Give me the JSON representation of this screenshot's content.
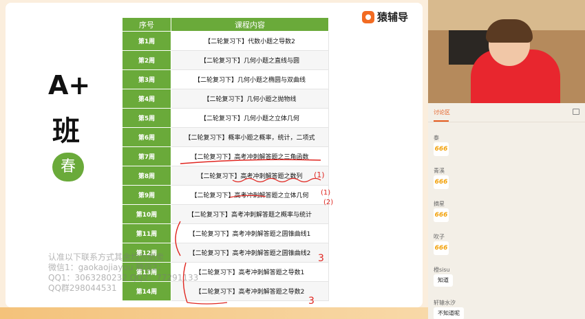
{
  "slide": {
    "grade_label": "A+",
    "class_label": "班",
    "season_badge": "春",
    "logo_text": "猿辅导"
  },
  "table": {
    "headers": [
      "序号",
      "课程内容"
    ],
    "rows": [
      {
        "week": "第1周",
        "topic": "【二轮复习下】代数小题之导数2"
      },
      {
        "week": "第2周",
        "topic": "【二轮复习下】几何小题之直线与圆"
      },
      {
        "week": "第3周",
        "topic": "【二轮复习下】几何小题之椭圆与双曲线"
      },
      {
        "week": "第4周",
        "topic": "【二轮复习下】几何小题之抛物线"
      },
      {
        "week": "第5周",
        "topic": "【二轮复习下】几何小题之立体几何"
      },
      {
        "week": "第6周",
        "topic": "【二轮复习下】概率小题之概率，统计，二项式"
      },
      {
        "week": "第7周",
        "topic": "【二轮复习下】高考冲刺解答题之三角函数"
      },
      {
        "week": "第8周",
        "topic": "【二轮复习下】高考冲刺解答题之数列"
      },
      {
        "week": "第9周",
        "topic": "【二轮复习下】高考冲刺解答题之立体几何"
      },
      {
        "week": "第10周",
        "topic": "【二轮复习下】高考冲刺解答题之概率与统计"
      },
      {
        "week": "第11周",
        "topic": "【二轮复习下】高考冲刺解答题之圆锥曲线1"
      },
      {
        "week": "第12周",
        "topic": "【二轮复习下】高考冲刺解答题之圆锥曲线2"
      },
      {
        "week": "第13周",
        "topic": "【二轮复习下】高考冲刺解答题之导数1"
      },
      {
        "week": "第14周",
        "topic": "【二轮复习下】高考冲刺解答题之导数2"
      }
    ]
  },
  "watermark": {
    "line1": "认准以下联系方式其余均为倒卖",
    "line2": "微信1：gaokaojiayou 微信2：",
    "line3": "QQ1：3063280232 QQ2：77291133",
    "line4": "QQ群298044531"
  },
  "annotations": [
    "(1)",
    "(1)",
    "(2)",
    "3",
    "3"
  ],
  "chat": {
    "tab_label": "讨论区",
    "messages": [
      {
        "user": "泰",
        "content": "666",
        "kind": "stamp"
      },
      {
        "user": "青溪",
        "content": "666",
        "kind": "stamp"
      },
      {
        "user": "摘星",
        "content": "666",
        "kind": "stamp"
      },
      {
        "user": "吹子",
        "content": "666",
        "kind": "stamp"
      },
      {
        "user": "橙sisu",
        "content": "知道",
        "kind": "text"
      },
      {
        "user": "轩辕水汐",
        "content": "不知道呢",
        "kind": "text"
      }
    ]
  },
  "colors": {
    "accent_green": "#6aaa3a",
    "logo_orange": "#f26b22",
    "chat_accent": "#e55b1e",
    "ink_red": "#e0251f"
  }
}
